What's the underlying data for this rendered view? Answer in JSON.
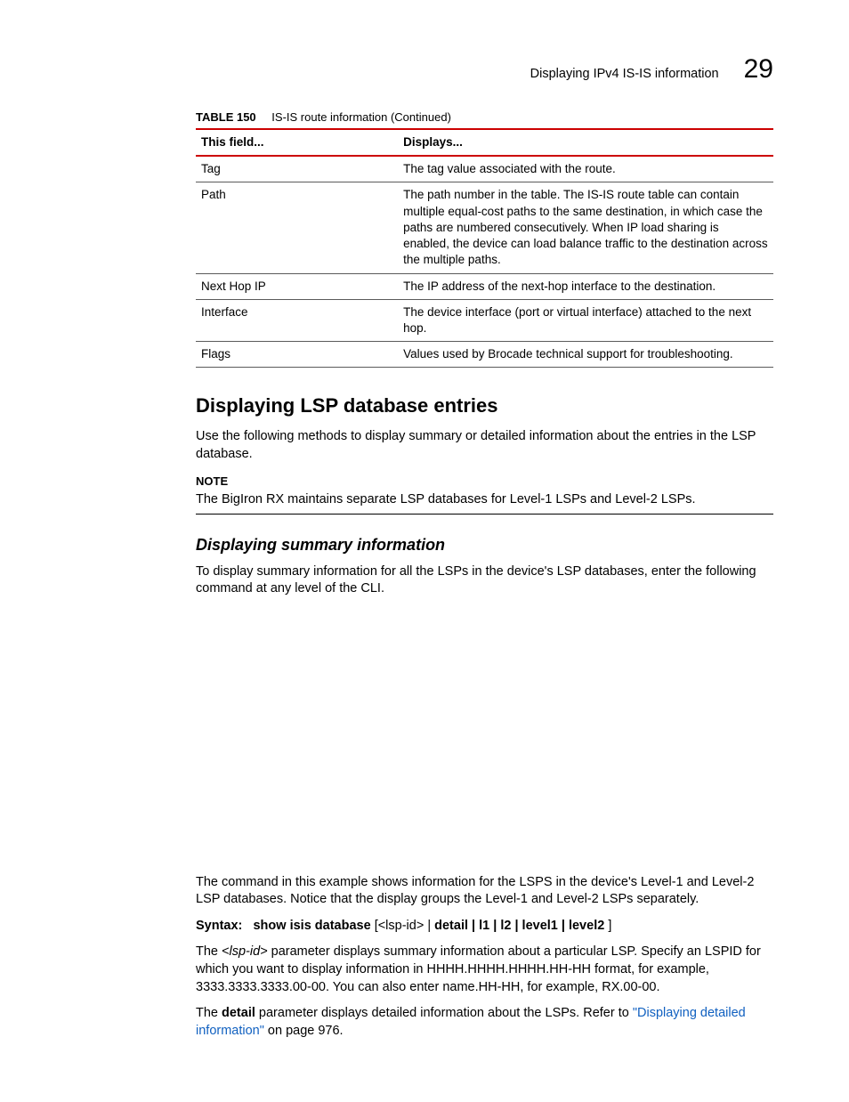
{
  "header": {
    "running_title": "Displaying IPv4 IS-IS information",
    "chapter_no": "29"
  },
  "table": {
    "label": "TABLE 150",
    "title": "IS-IS route information  (Continued)",
    "head_field": "This field...",
    "head_display": "Displays...",
    "rows": [
      {
        "field": "Tag",
        "desc": "The tag value associated with the route."
      },
      {
        "field": "Path",
        "desc": "The path number in the table. The IS-IS route table can contain multiple equal-cost paths to the same destination, in which case the paths are numbered consecutively. When IP load sharing is enabled, the device can load balance traffic to the destination across the multiple paths."
      },
      {
        "field": "Next Hop IP",
        "desc": "The IP address of the next-hop interface to the destination."
      },
      {
        "field": "Interface",
        "desc": "The device interface (port or virtual interface) attached to the next hop."
      },
      {
        "field": "Flags",
        "desc": "Values used by Brocade technical support for troubleshooting."
      }
    ]
  },
  "section1": {
    "heading": "Displaying LSP database entries",
    "intro": "Use the following methods to display summary or detailed information about the entries in the LSP database."
  },
  "note": {
    "label": "NOTE",
    "body": "The BigIron RX maintains separate LSP databases for Level-1 LSPs and Level-2 LSPs."
  },
  "subsection": {
    "heading": "Displaying summary information",
    "intro": "To display summary information for all the LSPs in the device's LSP databases, enter the following command at any level of the CLI."
  },
  "after_example": "The command in this example shows information for the LSPS in the device's Level-1 and Level-2 LSP databases. Notice that the display groups the Level-1 and Level-2 LSPs separately.",
  "syntax": {
    "prefix": "Syntax:",
    "cmd": "show isis database",
    "args": " [<lsp-id> | ",
    "bold_args": "detail | l1 | l2 | level1 | level2",
    "close": "]"
  },
  "para_lspid_a": "The ",
  "para_lspid_ital": "<lsp-id>",
  "para_lspid_b": " parameter displays summary information about a particular LSP. Specify an LSPID for which you want to display information in HHHH.HHHH.HHHH.HH-HH format, for example, 3333.3333.3333.00-00. You can also enter name.HH-HH, for example, RX.00-00.",
  "para_detail_a": "The ",
  "para_detail_bold": "detail",
  "para_detail_b": " parameter displays detailed information about the LSPs. Refer to ",
  "para_detail_link": "\"Displaying detailed information\"",
  "para_detail_c": " on page 976."
}
